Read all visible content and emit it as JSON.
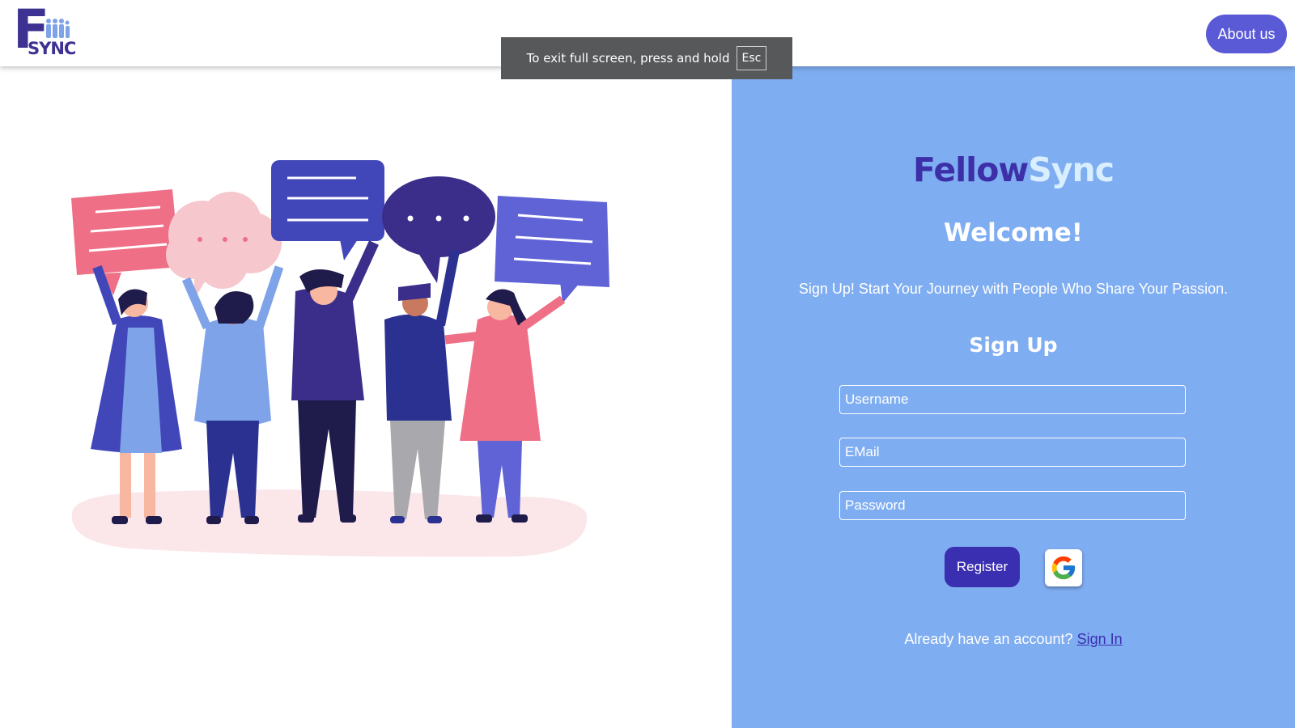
{
  "header": {
    "logo": {
      "letter": "F",
      "word": "SYNC"
    },
    "about_label": "About us"
  },
  "fullscreen_toast": {
    "message": "To exit full screen, press and hold",
    "key": "Esc"
  },
  "signup": {
    "brand_part1": "Fellow",
    "brand_part2": "Sync",
    "welcome": "Welcome!",
    "tagline": "Sign Up! Start Your Journey with People Who Share Your Passion.",
    "title": "Sign Up",
    "fields": {
      "username_placeholder": "Username",
      "email_placeholder": "EMail",
      "password_placeholder": "Password"
    },
    "register_label": "Register",
    "have_account_text": "Already have an account?",
    "signin_link": "Sign In"
  },
  "colors": {
    "panel_bg": "#7fadf1",
    "brand_dark": "#3d2fa8",
    "brand_light": "#d9efff",
    "register_bg": "#3b2fb1",
    "about_bg": "#5a59d6"
  },
  "icons": {
    "logo": "fsync-logo",
    "google": "google-icon",
    "illustration": "people-with-speech-bubbles"
  }
}
